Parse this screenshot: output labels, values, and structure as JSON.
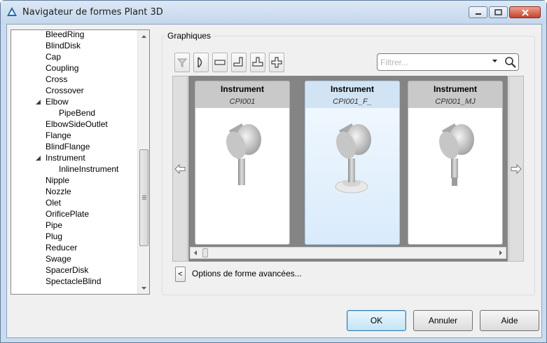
{
  "window": {
    "title": "Navigateur de formes Plant 3D",
    "icons": [
      "autocad-app-icon",
      "minimize-icon",
      "maximize-icon",
      "close-icon"
    ]
  },
  "tree": {
    "items": [
      {
        "label": "BleedRing",
        "level": 1,
        "expanded": false
      },
      {
        "label": "BlindDisk",
        "level": 1,
        "expanded": false
      },
      {
        "label": "Cap",
        "level": 1,
        "expanded": false
      },
      {
        "label": "Coupling",
        "level": 1,
        "expanded": false
      },
      {
        "label": "Cross",
        "level": 1,
        "expanded": false
      },
      {
        "label": "Crossover",
        "level": 1,
        "expanded": false
      },
      {
        "label": "Elbow",
        "level": 1,
        "expanded": true
      },
      {
        "label": "PipeBend",
        "level": 2,
        "expanded": false
      },
      {
        "label": "ElbowSideOutlet",
        "level": 1,
        "expanded": false
      },
      {
        "label": "Flange",
        "level": 1,
        "expanded": false
      },
      {
        "label": "BlindFlange",
        "level": 1,
        "expanded": false
      },
      {
        "label": "Instrument",
        "level": 1,
        "expanded": true
      },
      {
        "label": "InlineInstrument",
        "level": 2,
        "expanded": false
      },
      {
        "label": "Nipple",
        "level": 1,
        "expanded": false
      },
      {
        "label": "Nozzle",
        "level": 1,
        "expanded": false
      },
      {
        "label": "Olet",
        "level": 1,
        "expanded": false
      },
      {
        "label": "OrificePlate",
        "level": 1,
        "expanded": false
      },
      {
        "label": "Pipe",
        "level": 1,
        "expanded": false
      },
      {
        "label": "Plug",
        "level": 1,
        "expanded": false
      },
      {
        "label": "Reducer",
        "level": 1,
        "expanded": false
      },
      {
        "label": "Swage",
        "level": 1,
        "expanded": false
      },
      {
        "label": "SpacerDisk",
        "level": 1,
        "expanded": false
      },
      {
        "label": "SpectacleBlind",
        "level": 1,
        "expanded": false
      }
    ]
  },
  "graphics": {
    "group_title": "Graphiques",
    "toolbar_icons": [
      "filter-funnel-icon",
      "d-shape-icon",
      "straight-pipe-icon",
      "elbow-icon",
      "tee-icon",
      "cross-icon"
    ],
    "filter_placeholder": "Filtrer...",
    "cards": [
      {
        "category": "Instrument",
        "name": "CPI001",
        "selected": false
      },
      {
        "category": "Instrument",
        "name": "CPI001_F_",
        "selected": true
      },
      {
        "category": "Instrument",
        "name": "CPI001_MJ",
        "selected": false
      }
    ],
    "advanced_toggle": "<",
    "advanced_label": "Options de forme avancées..."
  },
  "buttons": {
    "ok": "OK",
    "cancel": "Annuler",
    "help": "Aide"
  }
}
